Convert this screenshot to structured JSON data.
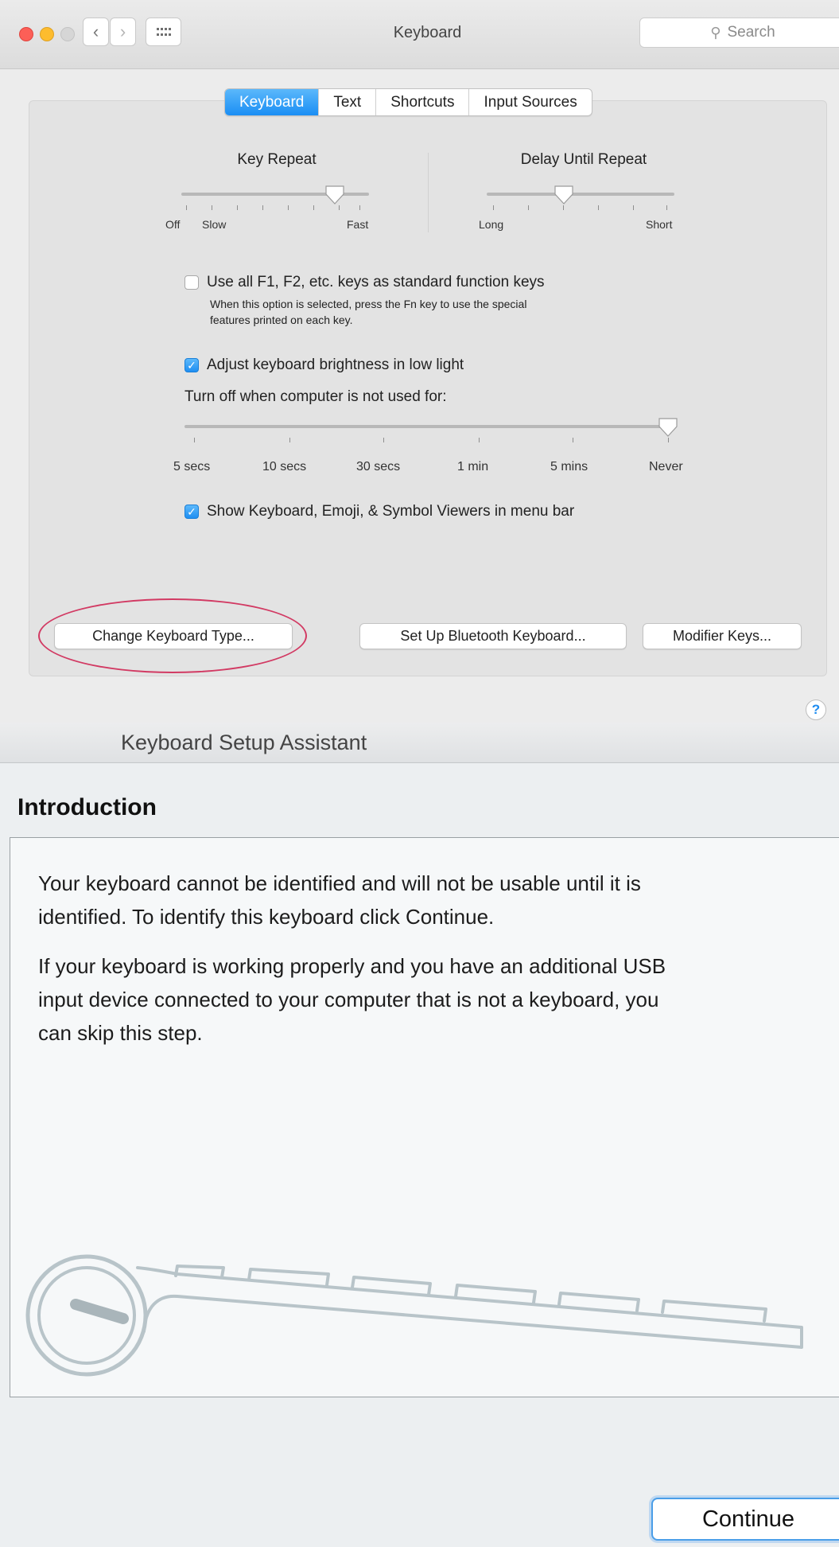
{
  "prefs_window": {
    "title": "Keyboard",
    "search_placeholder": "Search",
    "tabs": [
      {
        "label": "Keyboard",
        "active": true
      },
      {
        "label": "Text",
        "active": false
      },
      {
        "label": "Shortcuts",
        "active": false
      },
      {
        "label": "Input Sources",
        "active": false
      }
    ],
    "key_repeat": {
      "title": "Key Repeat",
      "min_label": "Off",
      "slow_label": "Slow",
      "max_label": "Fast",
      "value_fraction": 0.8
    },
    "delay_until_repeat": {
      "title": "Delay Until Repeat",
      "min_label": "Long",
      "max_label": "Short",
      "value_fraction": 0.4
    },
    "function_keys": {
      "label": "Use all F1, F2, etc. keys as standard function keys",
      "checked": false,
      "note_line1": "When this option is selected, press the Fn key to use the special",
      "note_line2": "features printed on each key."
    },
    "brightness": {
      "label": "Adjust keyboard brightness in low light",
      "checked": true
    },
    "turn_off_label": "Turn off when computer is not used for:",
    "turn_off_slider": {
      "labels": [
        "5 secs",
        "10 secs",
        "30 secs",
        "1 min",
        "5 mins",
        "Never"
      ],
      "selected": "Never"
    },
    "show_viewers": {
      "label": "Show Keyboard, Emoji, & Symbol Viewers in menu bar",
      "checked": true
    },
    "buttons": {
      "change_type": "Change Keyboard Type...",
      "bluetooth": "Set Up Bluetooth Keyboard...",
      "modifier": "Modifier Keys..."
    },
    "help": "?",
    "colors": {
      "accent": "#1a8ef4",
      "highlight_ring": "#d23a63"
    }
  },
  "assistant_window": {
    "title": "Keyboard Setup Assistant",
    "heading": "Introduction",
    "para1_line1": "Your keyboard cannot be identified and will not be usable until it is",
    "para1_line2": "identified. To identify this keyboard click Continue.",
    "para2_line1": "If your keyboard is working properly and you have an additional USB",
    "para2_line2": "input device connected to your computer that is not a keyboard, you",
    "para2_line3": "can skip this step.",
    "continue_label": "Continue"
  }
}
